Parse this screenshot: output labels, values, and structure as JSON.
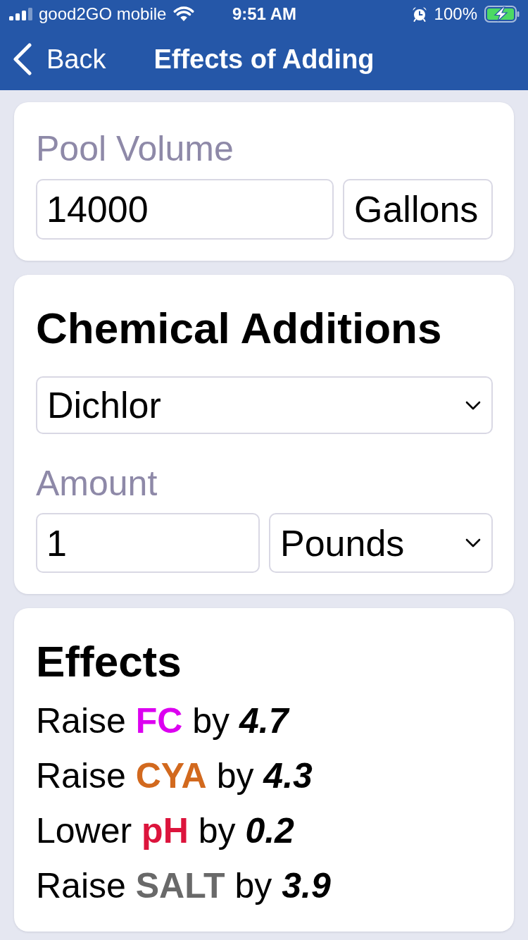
{
  "status_bar": {
    "carrier": "good2GO mobile",
    "time": "9:51 AM",
    "battery": "100%",
    "charging": true
  },
  "nav_bar": {
    "back": "Back",
    "title": "Effects of Adding"
  },
  "pool_volume": {
    "label": "Pool Volume",
    "value": "14000",
    "unit": "Gallons"
  },
  "chemical_additions": {
    "heading": "Chemical Additions",
    "chemical": "Dichlor",
    "amount_label": "Amount",
    "amount": "1",
    "amount_unit": "Pounds"
  },
  "effects": {
    "heading": "Effects",
    "items": [
      {
        "direction": "Raise",
        "parameter": "FC",
        "color": "#dc00f0",
        "connector": "by",
        "amount": "4.7"
      },
      {
        "direction": "Raise",
        "parameter": "CYA",
        "color": "#d2691e",
        "connector": "by",
        "amount": "4.3"
      },
      {
        "direction": "Lower",
        "parameter": "pH",
        "color": "#dc143c",
        "connector": "by",
        "amount": "0.2"
      },
      {
        "direction": "Raise",
        "parameter": "SALT",
        "color": "#696969",
        "connector": "by",
        "amount": "3.9"
      }
    ]
  }
}
